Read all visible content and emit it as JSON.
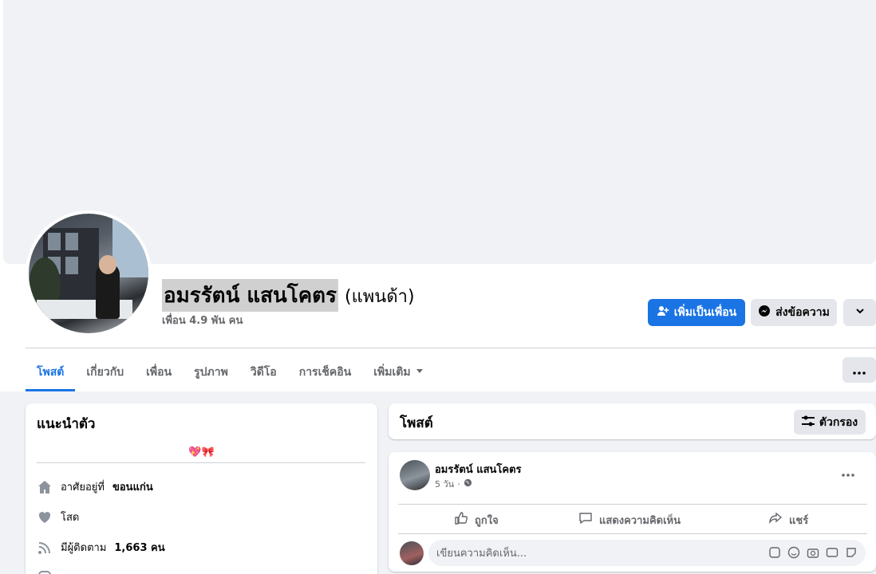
{
  "profile": {
    "name": "อมรรัตน์ แสนโคตร",
    "alt_name": "(แพนด้า)",
    "friends_count": "เพื่อน 4.9 พัน คน"
  },
  "actions": {
    "add_friend": "เพิ่มเป็นเพื่อน",
    "message": "ส่งข้อความ"
  },
  "tabs": [
    {
      "label": "โพสต์",
      "active": true
    },
    {
      "label": "เกี่ยวกับ"
    },
    {
      "label": "เพื่อน"
    },
    {
      "label": "รูปภาพ"
    },
    {
      "label": "วิดีโอ"
    },
    {
      "label": "การเช็คอิน"
    },
    {
      "label": "เพิ่มเติม"
    }
  ],
  "intro": {
    "title": "แนะนำตัว",
    "bio": "💖🎀",
    "lives_prefix": "อาศัยอยู่ที่",
    "lives_city": "ขอนแก่น",
    "relationship": "โสด",
    "followers_prefix": "มีผู้ติดตาม",
    "followers_count": "1,663 คน"
  },
  "posts": {
    "title": "โพสต์",
    "filter_label": "ตัวกรอง",
    "item": {
      "author": "อมรรัตน์ แสนโคตร",
      "time": "5 วัน",
      "like": "ถูกใจ",
      "comment": "แสดงความคิดเห็น",
      "share": "แชร์",
      "comment_placeholder": "เขียนความคิดเห็น..."
    }
  },
  "colors": {
    "accent": "#1b74e4",
    "background": "#f0f2f5",
    "secondary_text": "#65676b"
  }
}
